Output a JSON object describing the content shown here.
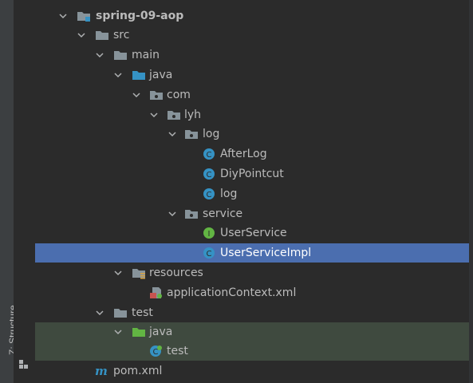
{
  "tool_window": {
    "stripe_tab_label": "Z: Structure"
  },
  "tree": [
    {
      "label": "spring-09-aop",
      "bold": true,
      "icon": "module-folder-icon"
    },
    {
      "label": "src",
      "icon": "folder-icon"
    },
    {
      "label": "main",
      "icon": "folder-icon"
    },
    {
      "label": "java",
      "icon": "source-root-folder-icon"
    },
    {
      "label": "com",
      "icon": "package-icon"
    },
    {
      "label": "lyh",
      "icon": "package-icon"
    },
    {
      "label": "log",
      "icon": "package-icon"
    },
    {
      "label": "AfterLog",
      "icon": "class-icon"
    },
    {
      "label": "DiyPointcut",
      "icon": "class-icon"
    },
    {
      "label": "log",
      "icon": "class-icon"
    },
    {
      "label": "service",
      "icon": "package-icon"
    },
    {
      "label": "UserService",
      "icon": "interface-icon"
    },
    {
      "label": "UserServiceImpl",
      "icon": "class-icon",
      "selected": true
    },
    {
      "label": "resources",
      "icon": "resources-folder-icon"
    },
    {
      "label": "applicationContext.xml",
      "icon": "spring-xml-file-icon"
    },
    {
      "label": "test",
      "icon": "folder-icon"
    },
    {
      "label": "java",
      "icon": "test-source-root-folder-icon"
    },
    {
      "label": "test",
      "icon": "test-class-icon"
    },
    {
      "label": "pom.xml",
      "icon": "maven-pom-icon"
    }
  ],
  "colors": {
    "selection": "#4b6eaf",
    "test_root_highlight": "#3f4a3f",
    "class_icon": "#3592c4",
    "interface_icon": "#62b543",
    "source_folder": "#3592c4",
    "test_folder": "#62b543",
    "folder": "#87939a"
  }
}
